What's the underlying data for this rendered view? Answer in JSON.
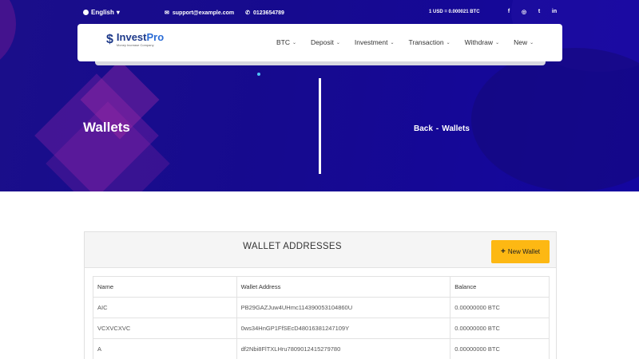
{
  "topbar": {
    "language": "English",
    "email": "support@example.com",
    "phone": "0123654789",
    "rate": "1 USD = 0.000021 BTC",
    "socials": [
      "f",
      "◎",
      "t",
      "in"
    ]
  },
  "brand": {
    "logo_mark": "$",
    "name_a": "Invest",
    "name_b": "Pro",
    "tagline": "Money Increase Company"
  },
  "menu": [
    {
      "label": "BTC"
    },
    {
      "label": "Deposit"
    },
    {
      "label": "Investment"
    },
    {
      "label": "Transaction"
    },
    {
      "label": "Withdraw"
    },
    {
      "label": "New"
    }
  ],
  "hero": {
    "title": "Wallets",
    "breadcrumb_back": "Back",
    "breadcrumb_sep": "-",
    "breadcrumb_current": "Wallets"
  },
  "panel": {
    "title": "WALLET ADDRESSES",
    "new_button": "New Wallet"
  },
  "table": {
    "headers": [
      "Name",
      "Wallet Address",
      "Balance"
    ],
    "rows": [
      [
        "AIC",
        "PB29GAZJuw4UHmc114390053104860U",
        "0.00000000 BTC"
      ],
      [
        "VCXVCXVC",
        "0ws34HnGP1FfSEcD48016381247109Y",
        "0.00000000 BTC"
      ],
      [
        "A",
        "df2Nbi8FlTXLHru7809012415279780",
        "0.00000000 BTC"
      ]
    ]
  },
  "colors": {
    "hero_bg": "#160a8f",
    "accent_button": "#fdb813",
    "brand_blue": "#1e3a8a"
  }
}
